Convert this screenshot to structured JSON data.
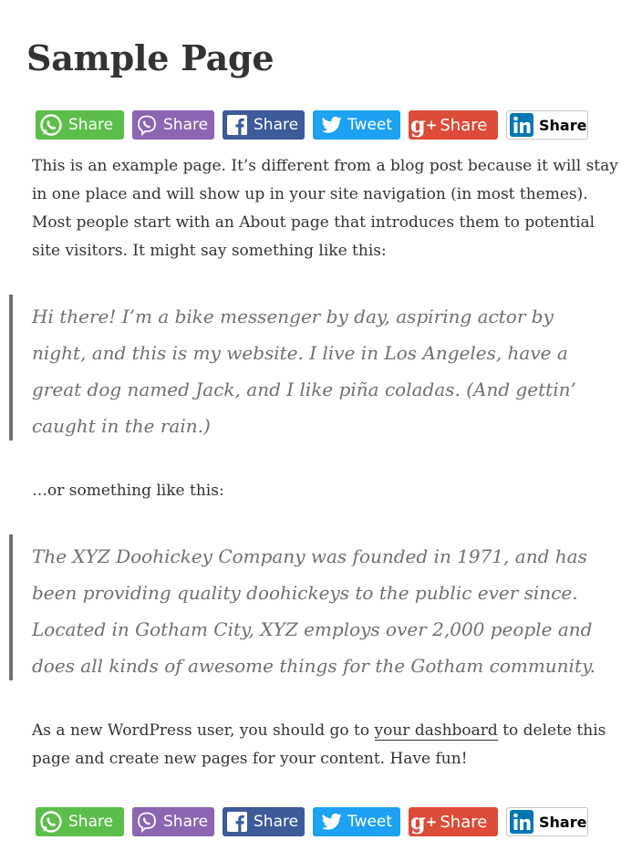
{
  "page": {
    "title": "Sample Page"
  },
  "share_buttons": [
    {
      "network": "whatsapp",
      "label": "Share",
      "icon": "whatsapp-icon",
      "color": "#5cbe4a"
    },
    {
      "network": "viber",
      "label": "Share",
      "icon": "viber-icon",
      "color": "#8c65b3"
    },
    {
      "network": "facebook",
      "label": "Share",
      "icon": "facebook-icon",
      "color": "#3d5a99"
    },
    {
      "network": "twitter",
      "label": "Tweet",
      "icon": "twitter-icon",
      "color": "#1da1f2"
    },
    {
      "network": "google-plus",
      "label": "Share",
      "icon": "google-plus-icon",
      "color": "#dd4b39"
    },
    {
      "network": "linkedin",
      "label": "Share",
      "icon": "linkedin-icon",
      "color": "#0077b5"
    }
  ],
  "content": {
    "intro": "This is an example page. It’s different from a blog post because it will stay in one place and will show up in your site navigation (in most themes). Most people start with an About page that introduces them to potential site visitors. It might say something like this:",
    "quote1": "Hi there! I’m a bike messenger by day, aspiring actor by night, and this is my website. I live in Los Angeles, have a great dog named Jack, and I like piña coladas. (And gettin’ caught in the rain.)",
    "middle": "…or something like this:",
    "quote2": "The XYZ Doohickey Company was founded in 1971, and has been providing quality doohickeys to the public ever since. Located in Gotham City, XYZ employs over 2,000 people and does all kinds of awesome things for the Gotham community.",
    "outro_before": "As a new WordPress user, you should go to ",
    "outro_link": "your dashboard",
    "outro_after": " to delete this page and create new pages for your content. Have fun!"
  }
}
